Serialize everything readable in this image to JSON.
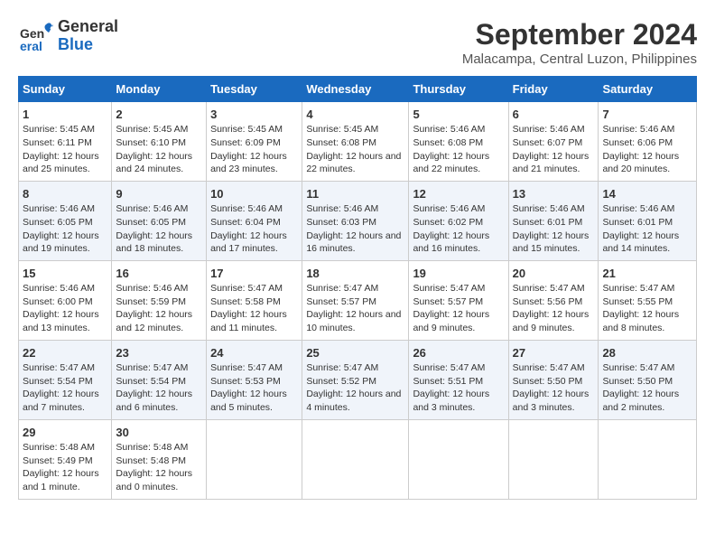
{
  "header": {
    "logo_general": "General",
    "logo_blue": "Blue",
    "title": "September 2024",
    "subtitle": "Malacampa, Central Luzon, Philippines"
  },
  "days_of_week": [
    "Sunday",
    "Monday",
    "Tuesday",
    "Wednesday",
    "Thursday",
    "Friday",
    "Saturday"
  ],
  "weeks": [
    [
      {
        "day": "1",
        "sunrise": "Sunrise: 5:45 AM",
        "sunset": "Sunset: 6:11 PM",
        "daylight": "Daylight: 12 hours and 25 minutes."
      },
      {
        "day": "2",
        "sunrise": "Sunrise: 5:45 AM",
        "sunset": "Sunset: 6:10 PM",
        "daylight": "Daylight: 12 hours and 24 minutes."
      },
      {
        "day": "3",
        "sunrise": "Sunrise: 5:45 AM",
        "sunset": "Sunset: 6:09 PM",
        "daylight": "Daylight: 12 hours and 23 minutes."
      },
      {
        "day": "4",
        "sunrise": "Sunrise: 5:45 AM",
        "sunset": "Sunset: 6:08 PM",
        "daylight": "Daylight: 12 hours and 22 minutes."
      },
      {
        "day": "5",
        "sunrise": "Sunrise: 5:46 AM",
        "sunset": "Sunset: 6:08 PM",
        "daylight": "Daylight: 12 hours and 22 minutes."
      },
      {
        "day": "6",
        "sunrise": "Sunrise: 5:46 AM",
        "sunset": "Sunset: 6:07 PM",
        "daylight": "Daylight: 12 hours and 21 minutes."
      },
      {
        "day": "7",
        "sunrise": "Sunrise: 5:46 AM",
        "sunset": "Sunset: 6:06 PM",
        "daylight": "Daylight: 12 hours and 20 minutes."
      }
    ],
    [
      {
        "day": "8",
        "sunrise": "Sunrise: 5:46 AM",
        "sunset": "Sunset: 6:05 PM",
        "daylight": "Daylight: 12 hours and 19 minutes."
      },
      {
        "day": "9",
        "sunrise": "Sunrise: 5:46 AM",
        "sunset": "Sunset: 6:05 PM",
        "daylight": "Daylight: 12 hours and 18 minutes."
      },
      {
        "day": "10",
        "sunrise": "Sunrise: 5:46 AM",
        "sunset": "Sunset: 6:04 PM",
        "daylight": "Daylight: 12 hours and 17 minutes."
      },
      {
        "day": "11",
        "sunrise": "Sunrise: 5:46 AM",
        "sunset": "Sunset: 6:03 PM",
        "daylight": "Daylight: 12 hours and 16 minutes."
      },
      {
        "day": "12",
        "sunrise": "Sunrise: 5:46 AM",
        "sunset": "Sunset: 6:02 PM",
        "daylight": "Daylight: 12 hours and 16 minutes."
      },
      {
        "day": "13",
        "sunrise": "Sunrise: 5:46 AM",
        "sunset": "Sunset: 6:01 PM",
        "daylight": "Daylight: 12 hours and 15 minutes."
      },
      {
        "day": "14",
        "sunrise": "Sunrise: 5:46 AM",
        "sunset": "Sunset: 6:01 PM",
        "daylight": "Daylight: 12 hours and 14 minutes."
      }
    ],
    [
      {
        "day": "15",
        "sunrise": "Sunrise: 5:46 AM",
        "sunset": "Sunset: 6:00 PM",
        "daylight": "Daylight: 12 hours and 13 minutes."
      },
      {
        "day": "16",
        "sunrise": "Sunrise: 5:46 AM",
        "sunset": "Sunset: 5:59 PM",
        "daylight": "Daylight: 12 hours and 12 minutes."
      },
      {
        "day": "17",
        "sunrise": "Sunrise: 5:47 AM",
        "sunset": "Sunset: 5:58 PM",
        "daylight": "Daylight: 12 hours and 11 minutes."
      },
      {
        "day": "18",
        "sunrise": "Sunrise: 5:47 AM",
        "sunset": "Sunset: 5:57 PM",
        "daylight": "Daylight: 12 hours and 10 minutes."
      },
      {
        "day": "19",
        "sunrise": "Sunrise: 5:47 AM",
        "sunset": "Sunset: 5:57 PM",
        "daylight": "Daylight: 12 hours and 9 minutes."
      },
      {
        "day": "20",
        "sunrise": "Sunrise: 5:47 AM",
        "sunset": "Sunset: 5:56 PM",
        "daylight": "Daylight: 12 hours and 9 minutes."
      },
      {
        "day": "21",
        "sunrise": "Sunrise: 5:47 AM",
        "sunset": "Sunset: 5:55 PM",
        "daylight": "Daylight: 12 hours and 8 minutes."
      }
    ],
    [
      {
        "day": "22",
        "sunrise": "Sunrise: 5:47 AM",
        "sunset": "Sunset: 5:54 PM",
        "daylight": "Daylight: 12 hours and 7 minutes."
      },
      {
        "day": "23",
        "sunrise": "Sunrise: 5:47 AM",
        "sunset": "Sunset: 5:54 PM",
        "daylight": "Daylight: 12 hours and 6 minutes."
      },
      {
        "day": "24",
        "sunrise": "Sunrise: 5:47 AM",
        "sunset": "Sunset: 5:53 PM",
        "daylight": "Daylight: 12 hours and 5 minutes."
      },
      {
        "day": "25",
        "sunrise": "Sunrise: 5:47 AM",
        "sunset": "Sunset: 5:52 PM",
        "daylight": "Daylight: 12 hours and 4 minutes."
      },
      {
        "day": "26",
        "sunrise": "Sunrise: 5:47 AM",
        "sunset": "Sunset: 5:51 PM",
        "daylight": "Daylight: 12 hours and 3 minutes."
      },
      {
        "day": "27",
        "sunrise": "Sunrise: 5:47 AM",
        "sunset": "Sunset: 5:50 PM",
        "daylight": "Daylight: 12 hours and 3 minutes."
      },
      {
        "day": "28",
        "sunrise": "Sunrise: 5:47 AM",
        "sunset": "Sunset: 5:50 PM",
        "daylight": "Daylight: 12 hours and 2 minutes."
      }
    ],
    [
      {
        "day": "29",
        "sunrise": "Sunrise: 5:48 AM",
        "sunset": "Sunset: 5:49 PM",
        "daylight": "Daylight: 12 hours and 1 minute."
      },
      {
        "day": "30",
        "sunrise": "Sunrise: 5:48 AM",
        "sunset": "Sunset: 5:48 PM",
        "daylight": "Daylight: 12 hours and 0 minutes."
      },
      {
        "day": "",
        "sunrise": "",
        "sunset": "",
        "daylight": ""
      },
      {
        "day": "",
        "sunrise": "",
        "sunset": "",
        "daylight": ""
      },
      {
        "day": "",
        "sunrise": "",
        "sunset": "",
        "daylight": ""
      },
      {
        "day": "",
        "sunrise": "",
        "sunset": "",
        "daylight": ""
      },
      {
        "day": "",
        "sunrise": "",
        "sunset": "",
        "daylight": ""
      }
    ]
  ]
}
